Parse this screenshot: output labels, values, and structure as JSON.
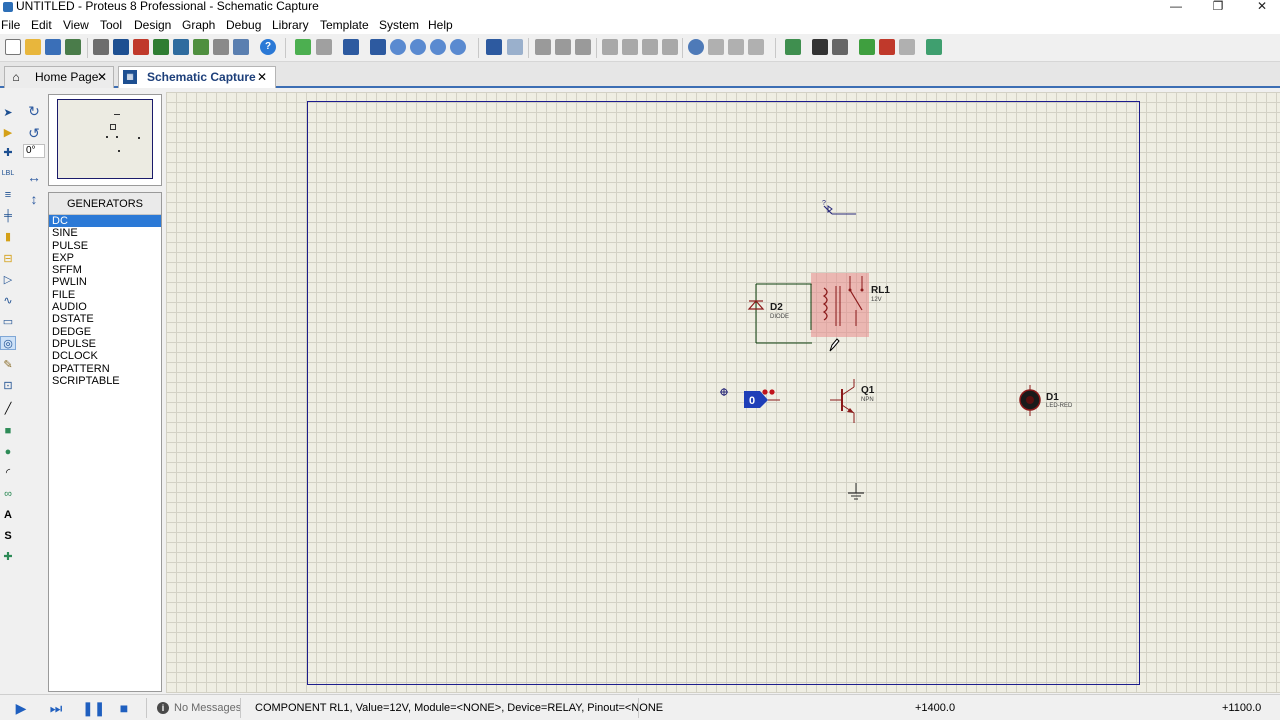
{
  "window": {
    "title": "UNTITLED - Proteus 8 Professional - Schematic Capture",
    "minimize": "—",
    "maximize": "❐",
    "close": "✕"
  },
  "menu": {
    "items": [
      "File",
      "Edit",
      "View",
      "Tool",
      "Design",
      "Graph",
      "Debug",
      "Library",
      "Template",
      "System",
      "Help"
    ]
  },
  "tabs": [
    {
      "label": "Home Page",
      "icon": "home-icon",
      "close": "✕"
    },
    {
      "label": "Schematic Capture",
      "icon": "schematic-icon",
      "close": "✕"
    }
  ],
  "rotation": {
    "angle": "0°"
  },
  "generators": {
    "header": "GENERATORS",
    "selected": "DC",
    "items": [
      "DC",
      "SINE",
      "PULSE",
      "EXP",
      "SFFM",
      "PWLIN",
      "FILE",
      "AUDIO",
      "DSTATE",
      "DEDGE",
      "DPULSE",
      "DCLOCK",
      "DPATTERN",
      "SCRIPTABLE"
    ]
  },
  "schematic": {
    "relay": {
      "ref": "RL1",
      "value": "12V"
    },
    "diode": {
      "ref": "D2",
      "value": "DIODE"
    },
    "transistor": {
      "ref": "Q1",
      "value": "NPN"
    },
    "led": {
      "ref": "D1",
      "value": "LED-RED"
    },
    "logic_state": {
      "value": "0"
    },
    "probe": {
      "label": "?"
    }
  },
  "status": {
    "messages": "No Messages",
    "info": "COMPONENT RL1, Value=12V, Module=<NONE>, Device=RELAY, Pinout=<NONE",
    "coord_x": "+1400.0",
    "coord_y": "+1100.0"
  },
  "colors": {
    "accent": "#3c6eb4",
    "selection": "#2b79d6",
    "sheet_border": "#1c1c8c",
    "component": "#8b1a1a",
    "relay_highlight": "#f2b4b4"
  }
}
